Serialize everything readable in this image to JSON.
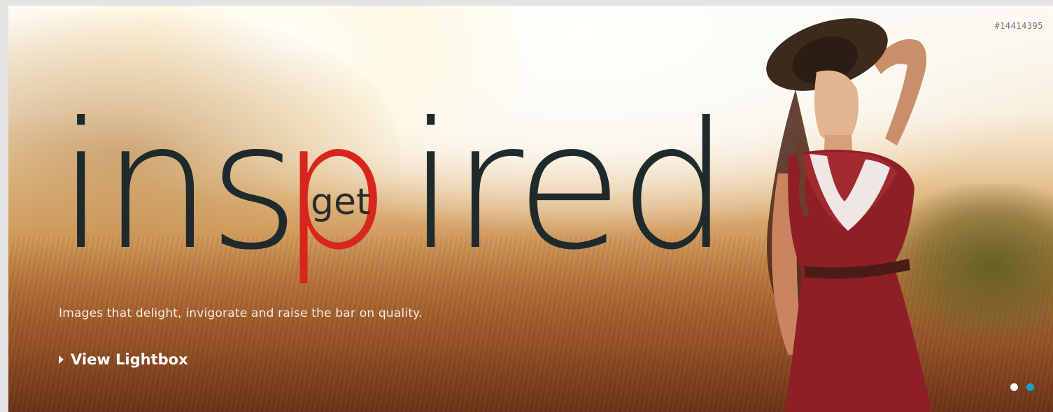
{
  "banner": {
    "image_id": "#14414395",
    "headline": {
      "left_part": "ins",
      "accent_letter": "p",
      "right_part": "ired",
      "accent_word": "get"
    },
    "tagline": "Images that delight, invigorate and raise the bar on quality.",
    "cta_label": "View Lightbox",
    "slide_count": 2,
    "active_slide": 1,
    "colors": {
      "headline_dark": "#1f2a2c",
      "headline_accent": "#d7261e",
      "dot_inactive": "#ffffff",
      "dot_active": "#1fa0c8"
    },
    "icons": {
      "cta": "caret-right-icon"
    }
  }
}
